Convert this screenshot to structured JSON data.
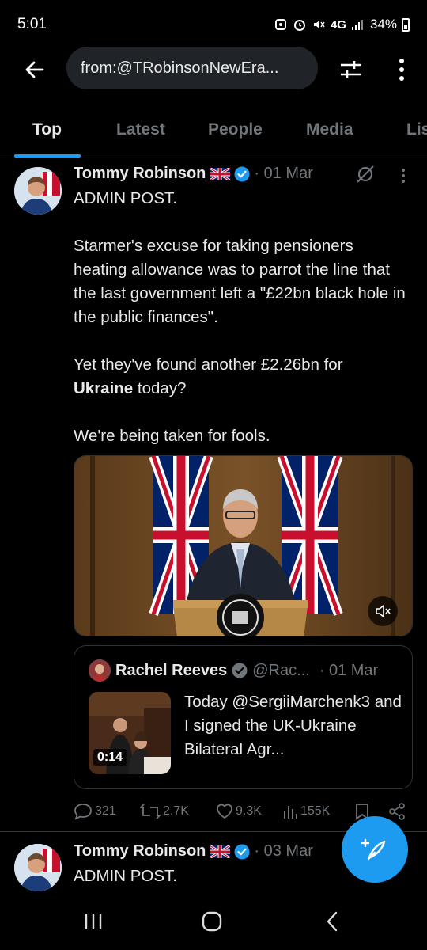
{
  "status_bar": {
    "time": "5:01",
    "network": "4G",
    "battery": "34%"
  },
  "header": {
    "search_query": "from:@TRobinsonNewEra..."
  },
  "tabs": [
    {
      "label": "Top",
      "active": true
    },
    {
      "label": "Latest",
      "active": false
    },
    {
      "label": "People",
      "active": false
    },
    {
      "label": "Media",
      "active": false
    },
    {
      "label": "Lis",
      "active": false
    }
  ],
  "tweets": [
    {
      "author": "Tommy Robinson",
      "date": "· 01 Mar",
      "text": {
        "line1": "ADMIN POST.",
        "para2": "Starmer's excuse for taking pensioners heating allowance was to parrot the line that the last government left a \"£22bn black hole in the public finances\".",
        "para3_before": "Yet they've found another £2.26bn for ",
        "para3_bold": "Ukraine",
        "para3_after": " today?",
        "para4": "We're being taken for fools."
      },
      "quote": {
        "author": "Rachel Reeves",
        "handle": "@Rac...",
        "date": "· 01 Mar",
        "duration": "0:14",
        "text": "Today @SergiiMarchenk3 and I signed the UK-Ukraine Bilateral Agr..."
      },
      "actions": {
        "replies": "321",
        "reposts": "2.7K",
        "likes": "9.3K",
        "views": "155K"
      }
    },
    {
      "author": "Tommy Robinson",
      "date": "· 03 Mar",
      "text": {
        "line1": "ADMIN POST."
      }
    }
  ],
  "colors": {
    "accent": "#1d9bf0",
    "background": "#000000",
    "muted": "#71767b",
    "text": "#e7e9ea"
  }
}
